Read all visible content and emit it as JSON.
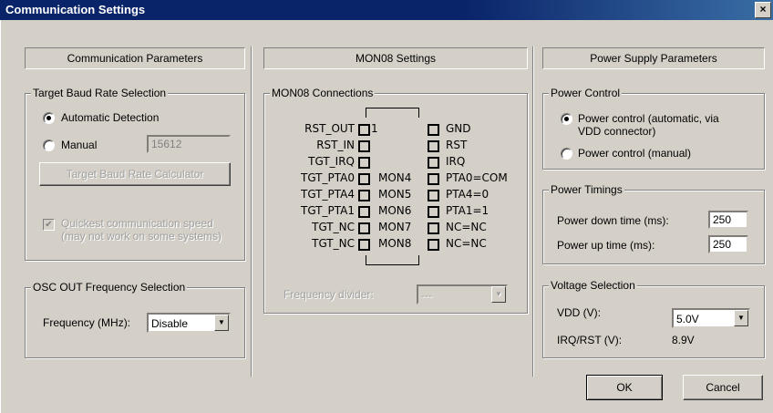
{
  "window": {
    "title": "Communication Settings",
    "close": "×"
  },
  "left": {
    "header": "Communication Parameters",
    "baud_group": "Target Baud Rate Selection",
    "auto_label": "Automatic Detection",
    "manual_label": "Manual",
    "manual_value": "15612",
    "calc_button": "Target Baud Rate Calculator",
    "quick_line1": "Quickest communication speed",
    "quick_line2": "(may not work on some systems)",
    "osc_group": "OSC OUT Frequency Selection",
    "freq_label": "Frequency (MHz):",
    "freq_value": "Disable"
  },
  "middle": {
    "header": "MON08 Settings",
    "group": "MON08 Connections",
    "rows": [
      {
        "left": "RST_OUT",
        "pin": "1",
        "mon": "",
        "right": "GND"
      },
      {
        "left": "RST_IN",
        "pin": "",
        "mon": "",
        "right": "RST"
      },
      {
        "left": "TGT_IRQ",
        "pin": "",
        "mon": "",
        "right": "IRQ"
      },
      {
        "left": "TGT_PTA0",
        "pin": "",
        "mon": "MON4",
        "right": "PTA0=COM"
      },
      {
        "left": "TGT_PTA4",
        "pin": "",
        "mon": "MON5",
        "right": "PTA4=0"
      },
      {
        "left": "TGT_PTA1",
        "pin": "",
        "mon": "MON6",
        "right": "PTA1=1"
      },
      {
        "left": "TGT_NC",
        "pin": "",
        "mon": "MON7",
        "right": "NC=NC"
      },
      {
        "left": "TGT_NC",
        "pin": "",
        "mon": "MON8",
        "right": "NC=NC"
      }
    ],
    "divider_label": "Frequency divider:",
    "divider_value": "---"
  },
  "right": {
    "header": "Power Supply Parameters",
    "power_group": "Power Control",
    "auto_line1": "Power control (automatic, via",
    "auto_line2": "VDD connector)",
    "manual_label": "Power control (manual)",
    "timings_group": "Power Timings",
    "down_label": "Power down time (ms):",
    "down_value": "250",
    "up_label": "Power up time (ms):",
    "up_value": "250",
    "voltage_group": "Voltage Selection",
    "vdd_label": "VDD (V):",
    "vdd_value": "5.0V",
    "irq_label": "IRQ/RST (V):",
    "irq_value": "8.9V"
  },
  "buttons": {
    "ok": "OK",
    "cancel": "Cancel"
  }
}
